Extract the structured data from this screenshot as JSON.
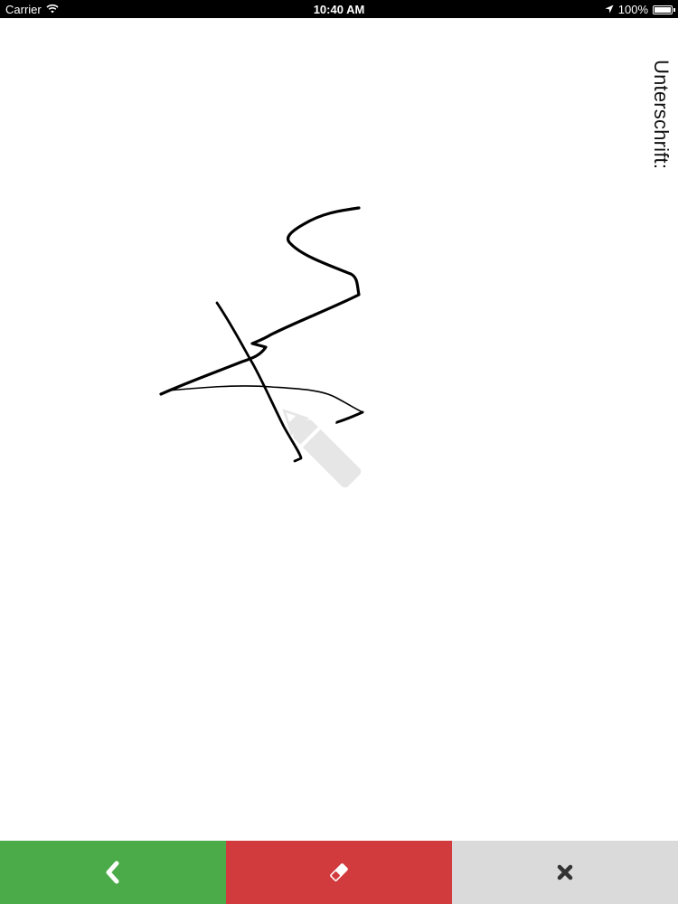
{
  "status_bar": {
    "carrier": "Carrier",
    "time": "10:40 AM",
    "battery": "100%",
    "battery_level": 1.0,
    "icons": [
      "wifi-icon",
      "location-arrow-icon",
      "battery-icon"
    ]
  },
  "signature": {
    "label": "Unterschrift:",
    "watermark_icon": "pencil-icon"
  },
  "toolbar": {
    "buttons": [
      {
        "icon": "chevron-left-icon",
        "color": "#4aab48"
      },
      {
        "icon": "eraser-icon",
        "color": "#d23b3e"
      },
      {
        "icon": "close-icon",
        "color": "#dadadb"
      }
    ]
  }
}
